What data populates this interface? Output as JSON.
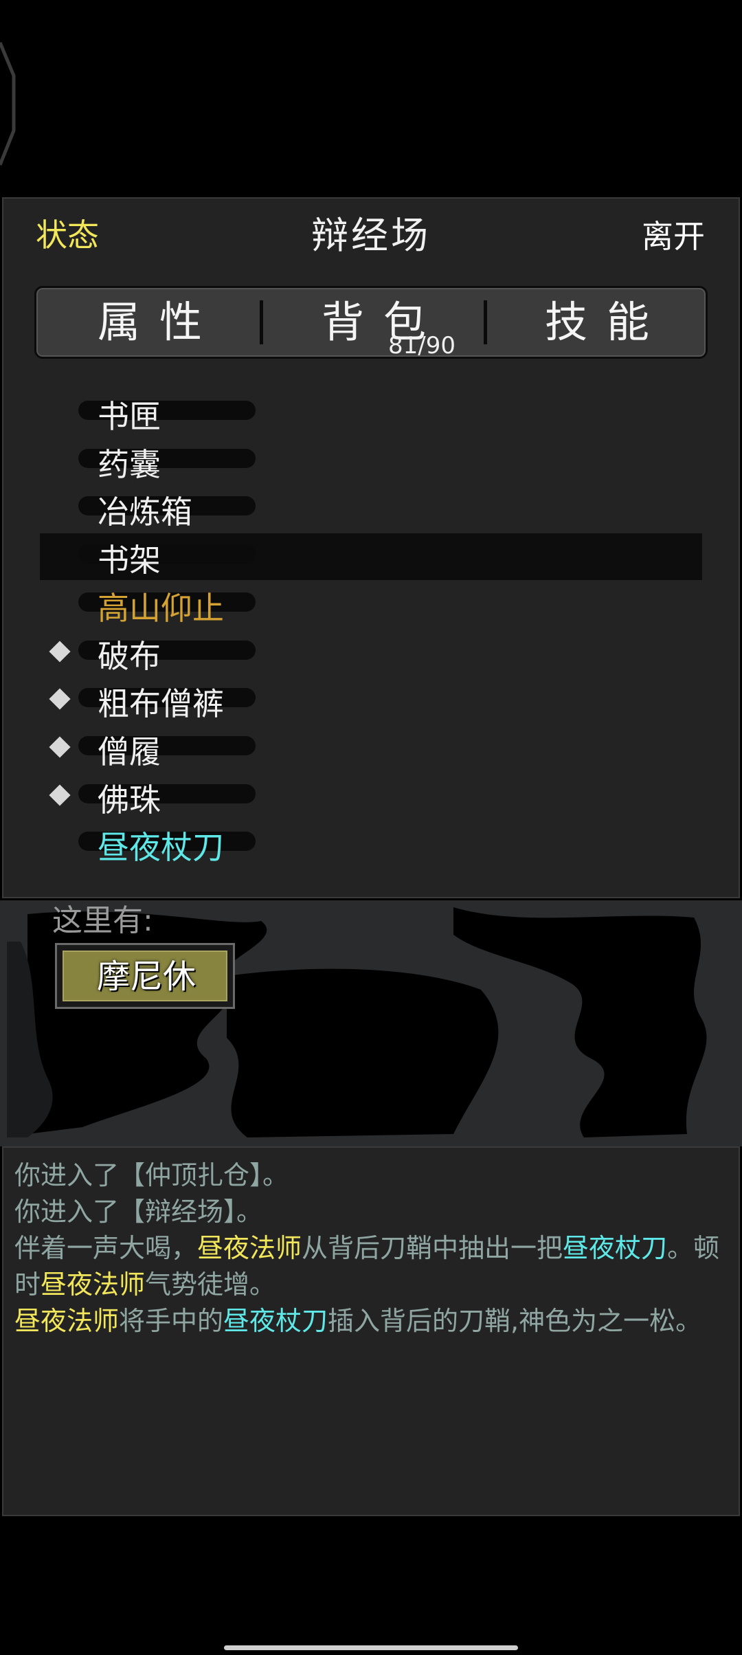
{
  "header": {
    "left": "状态",
    "title": "辩经场",
    "right": "离开"
  },
  "tabs": [
    {
      "label": "属性"
    },
    {
      "label": "背包",
      "count": "81/90"
    },
    {
      "label": "技能"
    }
  ],
  "items": [
    {
      "label": "书匣",
      "color": "#f0f0f0",
      "equipped": false,
      "selected": false
    },
    {
      "label": "药囊",
      "color": "#f0f0f0",
      "equipped": false,
      "selected": false
    },
    {
      "label": "冶炼箱",
      "color": "#f0f0f0",
      "equipped": false,
      "selected": false
    },
    {
      "label": "书架",
      "color": "#f0f0f0",
      "equipped": false,
      "selected": true
    },
    {
      "label": "高山仰止",
      "color": "#d4a232",
      "equipped": false,
      "selected": false
    },
    {
      "label": "破布",
      "color": "#f0f0f0",
      "equipped": true,
      "selected": false
    },
    {
      "label": "粗布僧裤",
      "color": "#f0f0f0",
      "equipped": true,
      "selected": false
    },
    {
      "label": "僧履",
      "color": "#f0f0f0",
      "equipped": true,
      "selected": false
    },
    {
      "label": "佛珠",
      "color": "#f0f0f0",
      "equipped": true,
      "selected": false
    },
    {
      "label": "昼夜杖刀",
      "color": "#5fe8e8",
      "equipped": false,
      "selected": false
    }
  ],
  "here": {
    "label": "这里有:",
    "npc": "摩尼休"
  },
  "log": {
    "line1": "你进入了【仲顶扎仓】。",
    "line2": "你进入了【辩经场】。",
    "l3_a": "伴着一声大喝，",
    "l3_b": "昼夜法师",
    "l3_c": "从背后刀鞘中抽出一把",
    "l3_d": "昼夜杖刀",
    "l3_e": "。顿时",
    "l3_f": "昼夜法师",
    "l3_g": "气势徒增。",
    "l4_a": "昼夜法师",
    "l4_b": "将手中的",
    "l4_c": "昼夜杖刀",
    "l4_d": "插入背后的刀鞘,神色为之一松。"
  },
  "colors": {
    "yellow": "#f2e65a",
    "cyan": "#5fe8e8",
    "gold": "#d4a232",
    "log_text": "#8fa6a3"
  }
}
